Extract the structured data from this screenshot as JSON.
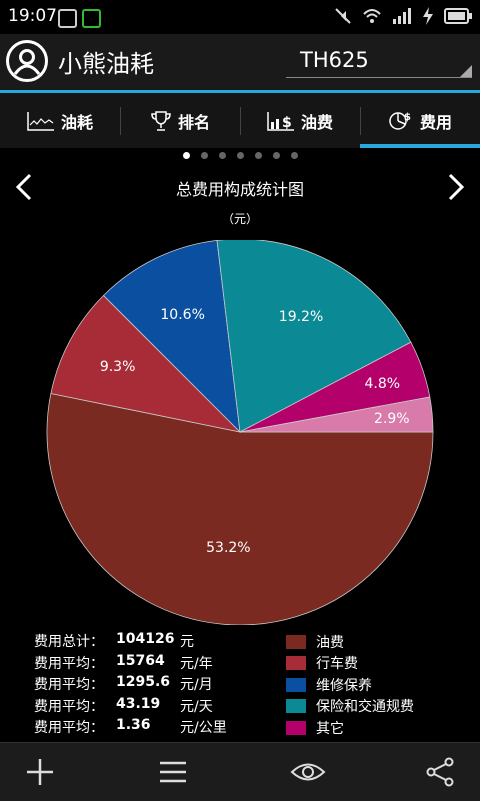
{
  "status_bar": {
    "time": "19:07"
  },
  "app": {
    "title": "小熊油耗",
    "vehicle": "TH625"
  },
  "tabs": [
    {
      "label": "油耗",
      "icon": "line-chart-icon"
    },
    {
      "label": "排名",
      "icon": "trophy-icon"
    },
    {
      "label": "油费",
      "icon": "bar-chart-dollar-icon"
    },
    {
      "label": "费用",
      "icon": "pie-chart-dollar-icon",
      "active": true
    }
  ],
  "pager": {
    "count": 7,
    "active": 0
  },
  "chart_data": {
    "type": "pie",
    "title": "总费用构成统计图",
    "unit": "（元）",
    "slices": [
      {
        "name": "油费",
        "value": 53.2,
        "label": "53.2%",
        "color": "#7a2a20"
      },
      {
        "name": "行车费",
        "value": 9.3,
        "label": "9.3%",
        "color": "#a82c38"
      },
      {
        "name": "维修保养",
        "value": 10.6,
        "label": "10.6%",
        "color": "#0b4fa0"
      },
      {
        "name": "保险和交通规费",
        "value": 19.2,
        "label": "19.2%",
        "color": "#0b8a96"
      },
      {
        "name": "其它",
        "value": 4.8,
        "label": "4.8%",
        "color": "#b4006a"
      },
      {
        "name": "",
        "value": 2.9,
        "label": "2.9%",
        "color": "#d87aaa"
      }
    ]
  },
  "summary": [
    {
      "label": "费用总计：",
      "value": "104126",
      "unit": "元"
    },
    {
      "label": "费用平均：",
      "value": "15764",
      "unit": "元/年"
    },
    {
      "label": "费用平均：",
      "value": "1295.6",
      "unit": "元/月"
    },
    {
      "label": "费用平均：",
      "value": "43.19",
      "unit": "元/天"
    },
    {
      "label": "费用平均：",
      "value": "1.36",
      "unit": "元/公里"
    }
  ],
  "legend": [
    {
      "label": "油费",
      "color": "#7a2a20"
    },
    {
      "label": "行车费",
      "color": "#a82c38"
    },
    {
      "label": "维修保养",
      "color": "#0b4fa0"
    },
    {
      "label": "保险和交通规费",
      "color": "#0b8a96"
    },
    {
      "label": "其它",
      "color": "#b4006a"
    }
  ],
  "bottom_bar": [
    "add-icon",
    "menu-icon",
    "eye-icon",
    "share-icon"
  ]
}
